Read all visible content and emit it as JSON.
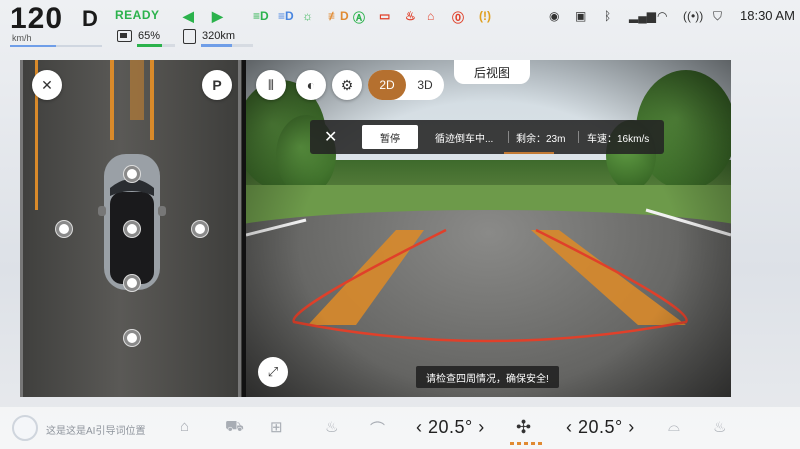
{
  "status": {
    "speed": "120",
    "speed_unit": "km/h",
    "speed_level": 0.5,
    "gear": "D",
    "ready": "READY",
    "battery": "65%",
    "battery_level": 0.65,
    "range": "320km",
    "range_level": 0.6,
    "time": "18:30 AM",
    "icons": [
      "turn-left-icon",
      "turn-right-icon",
      "headlight-icon",
      "low-beam-icon",
      "position-lamp-icon",
      "fog-lamp-icon",
      "auto-hold-icon",
      "battery-warning-icon",
      "coolant-temp-icon",
      "engine-fault-icon",
      "brake-warning-icon",
      "tire-pressure-icon",
      "user-icon",
      "camera-icon",
      "bluetooth-icon",
      "signal-icon",
      "wifi-icon",
      "hotspot-icon",
      "shield-icon"
    ]
  },
  "panel": {
    "mode_2d": "2D",
    "mode_3d": "3D",
    "view_tab": "后视图",
    "reverse": {
      "pause": "暂停",
      "status": "循迹倒车中...",
      "remaining": "剩余：23m",
      "speed": "车速：16km/s"
    },
    "warning": "请检查四周情况，确保安全!"
  },
  "dock": {
    "ai_hint": "这是这是AI引导词位置",
    "temp_left": "20.5°",
    "temp_right": "20.5°"
  },
  "colors": {
    "ready_green": "#2bb24c",
    "accent_orange": "#b5702f",
    "trajectory_red": "#e0402a",
    "lane_orange": "#d98a2a"
  }
}
